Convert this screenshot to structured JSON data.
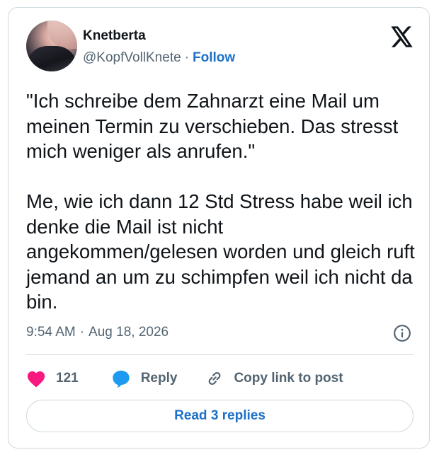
{
  "author": {
    "display_name": "Knetberta",
    "handle": "@KopfVollKnete",
    "separator": "·",
    "follow_label": "Follow"
  },
  "tweet": {
    "text": "\"Ich schreibe dem Zahnarzt eine Mail um meinen Termin zu verschieben. Das stresst mich weniger als anrufen.\"\n\nMe, wie ich dann 12 Std Stress habe weil ich denke die Mail ist nicht angekommen/gelesen worden und gleich ruft jemand an um zu schimpfen weil ich nicht da bin.",
    "time": "9:54 AM",
    "separator": "·",
    "date": "Aug 18, 2026"
  },
  "actions": {
    "like_count": "121",
    "reply_label": "Reply",
    "copy_link_label": "Copy link to post"
  },
  "read_replies_label": "Read 3 replies",
  "colors": {
    "like": "#f91880",
    "reply": "#1d9bf0",
    "link": "#1d70c8",
    "secondary_text": "#536471",
    "border": "#cfd9de"
  },
  "icons": [
    "x-logo-icon",
    "info-icon",
    "heart-icon",
    "reply-bubble-icon",
    "link-icon"
  ]
}
